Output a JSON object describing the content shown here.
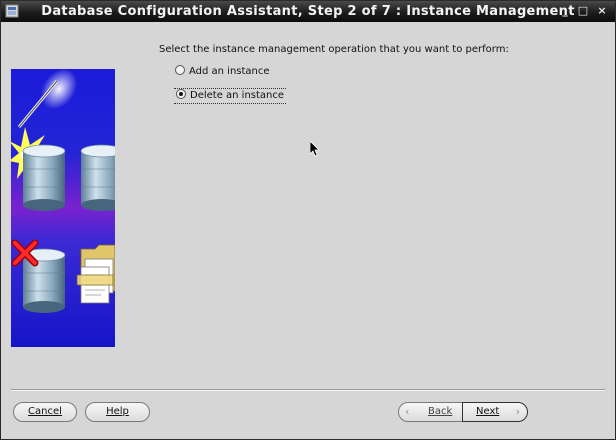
{
  "window": {
    "title": "Database Configuration Assistant, Step 2 of 7 : Instance Management",
    "controls": {
      "minimize": "_",
      "maximize": "□",
      "close": "×"
    }
  },
  "content": {
    "prompt": "Select the instance management operation that you want to perform:",
    "options": [
      {
        "label": "Add an instance",
        "selected": false
      },
      {
        "label": "Delete an instance",
        "selected": true
      }
    ]
  },
  "buttons": {
    "cancel": "Cancel",
    "help": "Help",
    "back": "Back",
    "next": "Next"
  },
  "icons": {
    "title": "oracle-app-icon",
    "wizard_image": "database-wizard-illustration",
    "back": "chevron-left-icon",
    "next": "chevron-right-icon",
    "cursor": "mouse-pointer-icon"
  },
  "colors": {
    "title_bar": "#111111",
    "window_bg": "#d6d6d6",
    "wizard_bg_top": "#1a1ad8",
    "wizard_bg_mid": "#6a1fd0"
  }
}
